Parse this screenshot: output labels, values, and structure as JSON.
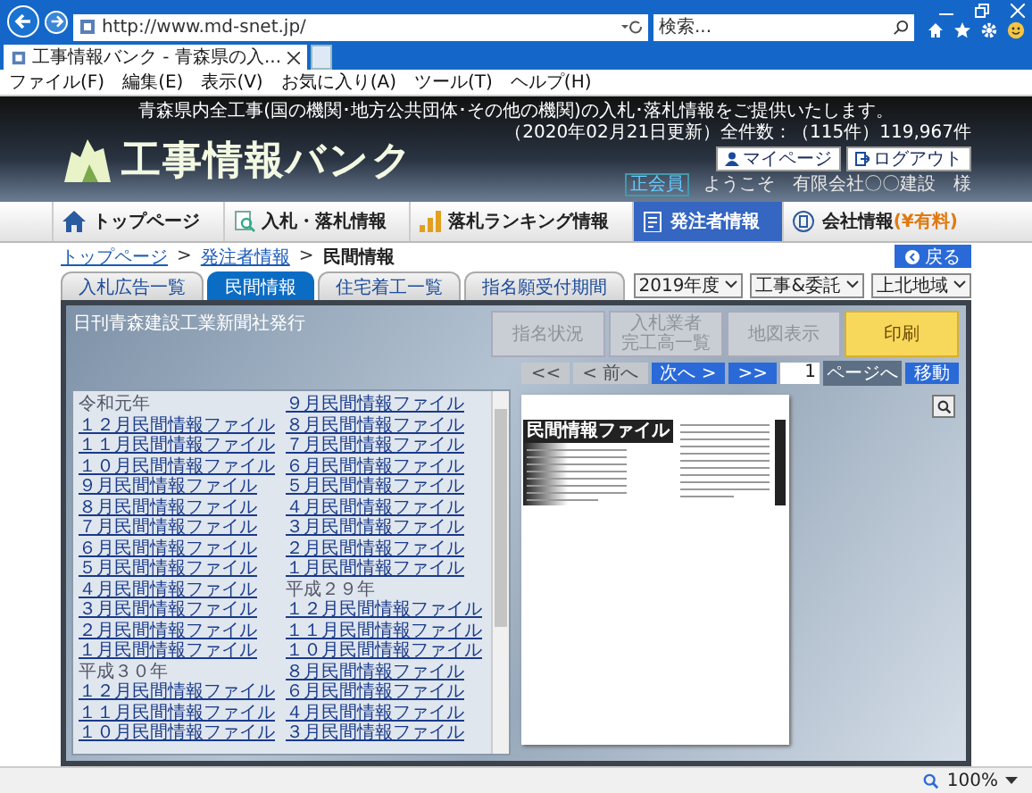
{
  "browser": {
    "url": "http://www.md-snet.jp/",
    "search_placeholder": "検索...",
    "tab_title": "工事情報バンク - 青森県の入...",
    "menu": [
      "ファイル(F)",
      "編集(E)",
      "表示(V)",
      "お気に入り(A)",
      "ツール(T)",
      "ヘルプ(H)"
    ]
  },
  "header": {
    "tagline": "青森県内全工事(国の機関･地方公共団体･その他の機関)の入札･落札情報をご提供いたします。",
    "update_info": "（2020年02月21日更新）全件数：（115件）119,967件",
    "logo": "工事情報バンク",
    "buttons": [
      "マイページ",
      "ログアウト"
    ],
    "member_badge": "正会員",
    "welcome": "ようこそ　有限会社〇〇建設　様"
  },
  "nav": [
    {
      "label": "トップページ",
      "selected": false
    },
    {
      "label": "入札・落札情報",
      "selected": false
    },
    {
      "label": "落札ランキング情報",
      "selected": false
    },
    {
      "label": "発注者情報",
      "selected": true
    },
    {
      "label": "会社情報",
      "note": "(¥有料)",
      "selected": false
    }
  ],
  "breadcrumb": [
    {
      "label": "トップページ",
      "link": true
    },
    {
      "label": "発注者情報",
      "link": true
    },
    {
      "label": "民間情報",
      "link": false
    }
  ],
  "breadcrumb_separator": ">",
  "back_button": "戻る",
  "tabs": [
    {
      "label": "入札広告一覧",
      "selected": false
    },
    {
      "label": "民間情報",
      "selected": true
    },
    {
      "label": "住宅着工一覧",
      "selected": false
    },
    {
      "label": "指名願受付期間",
      "selected": false
    }
  ],
  "filters": [
    "2019年度",
    "工事&委託",
    "上北地域"
  ],
  "viewer": {
    "source": "日刊青森建設工業新聞社発行",
    "actions": [
      {
        "lines": [
          "指名状況"
        ],
        "disabled": true
      },
      {
        "lines": [
          "入札業者",
          "完工高一覧"
        ],
        "disabled": true
      },
      {
        "lines": [
          "地図表示"
        ],
        "disabled": true
      },
      {
        "lines": [
          "印刷"
        ],
        "disabled": false
      }
    ],
    "pager": {
      "buttons": [
        {
          "label": "<<",
          "disabled": true
        },
        {
          "label": "< 前へ",
          "disabled": true
        },
        {
          "label": "次へ >",
          "disabled": false
        },
        {
          "label": ">>",
          "disabled": false
        }
      ],
      "page": "1",
      "page_suffix": "ページへ",
      "go": "移動"
    },
    "files": [
      {
        "label": "令和元年",
        "children": [
          "１２月民間情報ファイル",
          "１１月民間情報ファイル",
          "１０月民間情報ファイル",
          "９月民間情報ファイル",
          "８月民間情報ファイル",
          "７月民間情報ファイル",
          "６月民間情報ファイル",
          "５月民間情報ファイル",
          "４月民間情報ファイル",
          "３月民間情報ファイル",
          "２月民間情報ファイル",
          "１月民間情報ファイル"
        ]
      },
      {
        "label": "平成３０年",
        "children": [
          "１２月民間情報ファイル",
          "１１月民間情報ファイル",
          "１０月民間情報ファイル",
          "９月民間情報ファイル",
          "８月民間情報ファイル",
          "７月民間情報ファイル",
          "６月民間情報ファイル",
          "５月民間情報ファイル",
          "４月民間情報ファイル",
          "３月民間情報ファイル",
          "２月民間情報ファイル",
          "１月民間情報ファイル"
        ]
      },
      {
        "label": "平成２９年",
        "children": [
          "１２月民間情報ファイル",
          "１１月民間情報ファイル",
          "１０月民間情報ファイル",
          "８月民間情報ファイル",
          "６月民間情報ファイル",
          "４月民間情報ファイル",
          "３月民間情報ファイル"
        ]
      }
    ],
    "clipping_title": "民間情報ファイル"
  },
  "status_bar": {
    "zoom": "100%"
  }
}
